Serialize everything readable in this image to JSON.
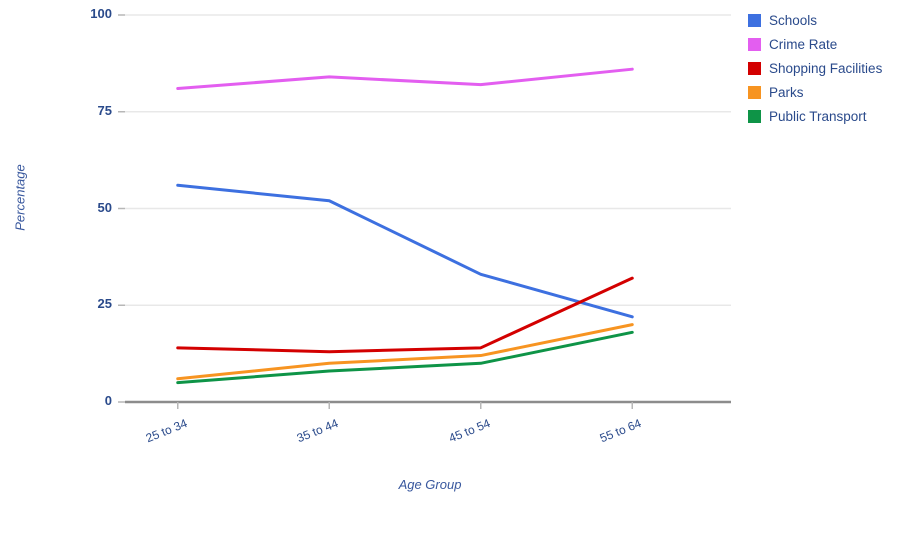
{
  "chart_data": {
    "type": "line",
    "title": "",
    "xlabel": "Age Group",
    "ylabel": "Percentage",
    "categories": [
      "25 to 34",
      "35 to 44",
      "45 to 54",
      "55 to 64"
    ],
    "ylim": [
      0,
      100
    ],
    "yticks": [
      0,
      25,
      50,
      75,
      100
    ],
    "ytick_labels": [
      "0",
      "25",
      "50",
      "75",
      "100"
    ],
    "grid": "horizontal",
    "legend_position": "right",
    "series": [
      {
        "name": "Schools",
        "color": "#3d70e0",
        "values": [
          56,
          52,
          33,
          22
        ]
      },
      {
        "name": "Crime Rate",
        "color": "#e35ef0",
        "values": [
          81,
          84,
          82,
          86
        ]
      },
      {
        "name": "Shopping Facilities",
        "color": "#d30000",
        "values": [
          14,
          13,
          14,
          32
        ]
      },
      {
        "name": "Parks",
        "color": "#f79421",
        "values": [
          6,
          10,
          12,
          20
        ]
      },
      {
        "name": "Public Transport",
        "color": "#0e9447",
        "values": [
          5,
          8,
          10,
          18
        ]
      }
    ]
  },
  "axes": {
    "y_title": "Percentage",
    "x_title": "Age Group"
  },
  "legend": {
    "items": [
      {
        "label": "Schools"
      },
      {
        "label": "Crime Rate"
      },
      {
        "label": "Shopping Facilities"
      },
      {
        "label": "Parks"
      },
      {
        "label": "Public Transport"
      }
    ]
  },
  "colors": {
    "schools": "#3d70e0",
    "crime_rate": "#e35ef0",
    "shopping_facilities": "#d30000",
    "parks": "#f79421",
    "public_transport": "#0e9447",
    "grid": "#e8e8e8",
    "baseline": "#8c8c8c",
    "text": "#2a4a8b"
  }
}
